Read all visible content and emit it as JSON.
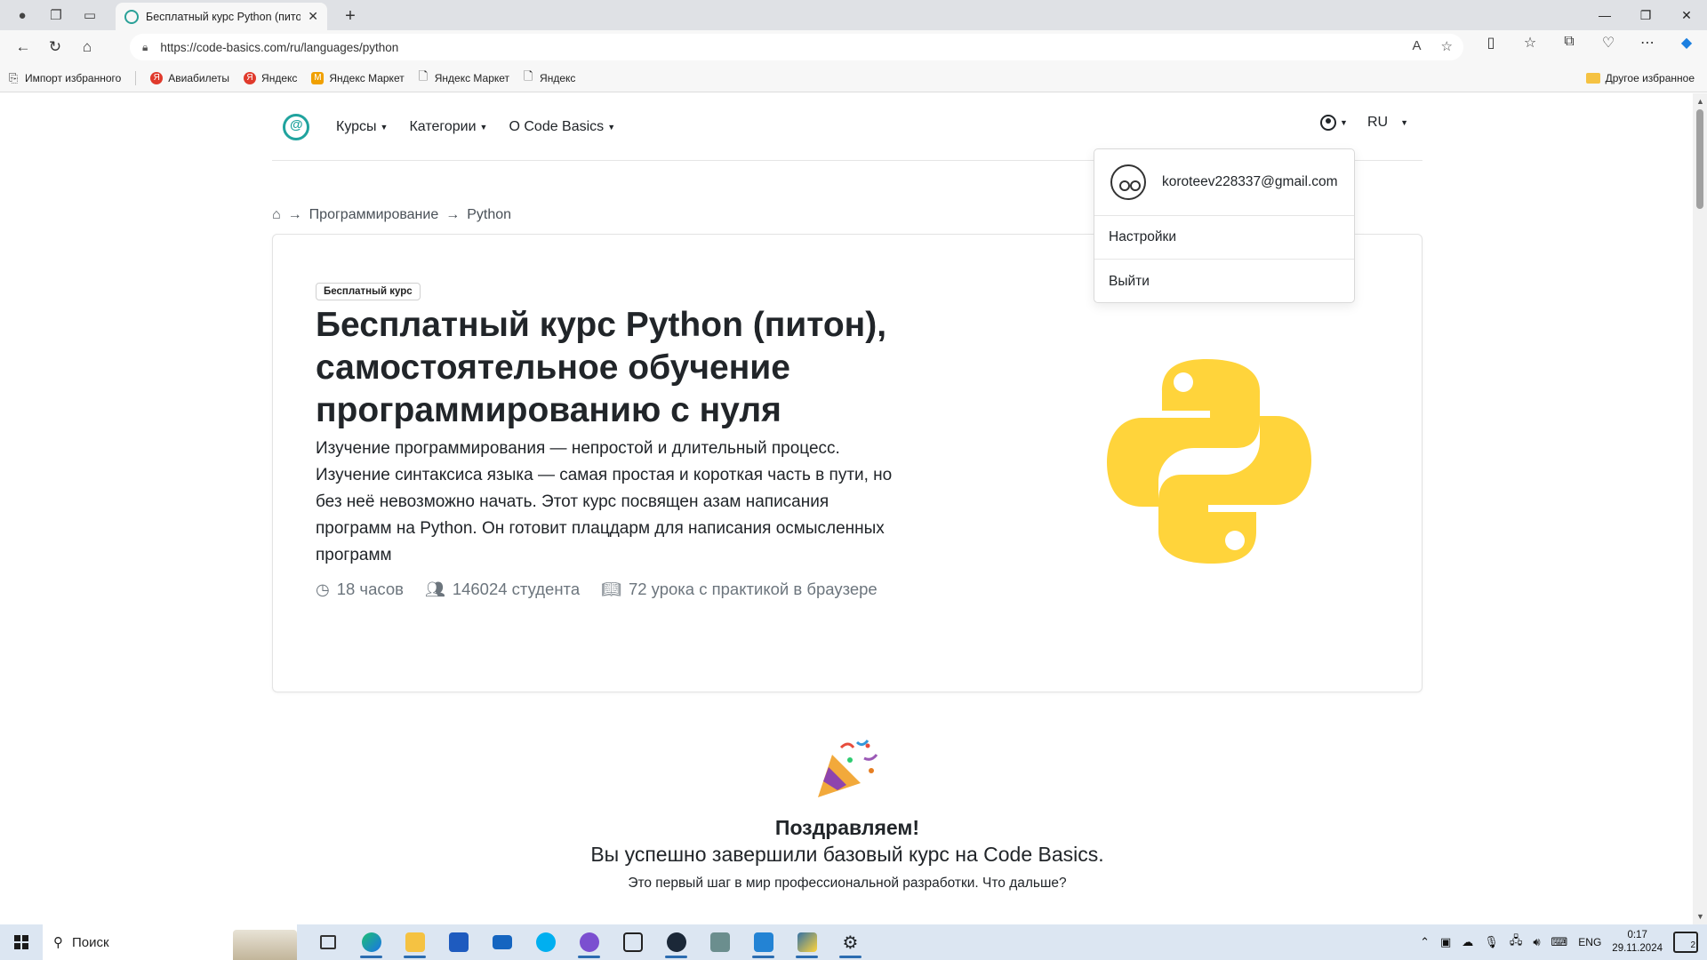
{
  "browser": {
    "tab_title": "Бесплатный курс Python (питон)",
    "url": "https://code-basics.com/ru/languages/python",
    "bookmarks": [
      {
        "label": "Импорт избранного",
        "icon": "import-icon"
      },
      {
        "label": "Авиабилеты",
        "icon": "yandex-icon"
      },
      {
        "label": "Яндекс",
        "icon": "yandex-icon"
      },
      {
        "label": "Яндекс Маркет",
        "icon": "market-icon"
      },
      {
        "label": "Яндекс Маркет",
        "icon": "page-icon"
      },
      {
        "label": "Яндекс",
        "icon": "page-icon"
      }
    ],
    "other_bookmarks": "Другое избранное"
  },
  "site": {
    "nav": {
      "courses": "Курсы",
      "categories": "Категории",
      "about": "О Code Basics",
      "lang": "RU"
    },
    "breadcrumb": {
      "section": "Программирование",
      "current": "Python",
      "separator": "→"
    },
    "course": {
      "badge": "Бесплатный курс",
      "title": "Бесплатный курс Python (питон), самостоятельное обучение программированию с нуля",
      "description": "Изучение программирования — непростой и длительный процесс. Изучение синтаксиса языка — самая простая и короткая часть в пути, но без неё невозможно начать. Этот курс посвящен азам написания программ на Python. Он готовит плацдарм для написания осмысленных программ",
      "stats": {
        "hours": "18 часов",
        "students": "146024 студента",
        "lessons": "72 урока с практикой в браузере"
      }
    },
    "user_menu": {
      "email": "koroteev228337@gmail.com",
      "settings": "Настройки",
      "logout": "Выйти"
    },
    "congrats": {
      "title": "Поздравляем!",
      "subtitle": "Вы успешно завершили базовый курс на Code Basics.",
      "note": "Это первый шаг в мир профессиональной разработки. Что дальше?"
    }
  },
  "taskbar": {
    "search_placeholder": "Поиск",
    "lang": "ENG",
    "time": "0:17",
    "date": "29.11.2024",
    "notifications": "2"
  },
  "colors": {
    "accent": "#20a39e",
    "python_yellow": "#ffd43b",
    "taskbar": "#dce6f2"
  }
}
